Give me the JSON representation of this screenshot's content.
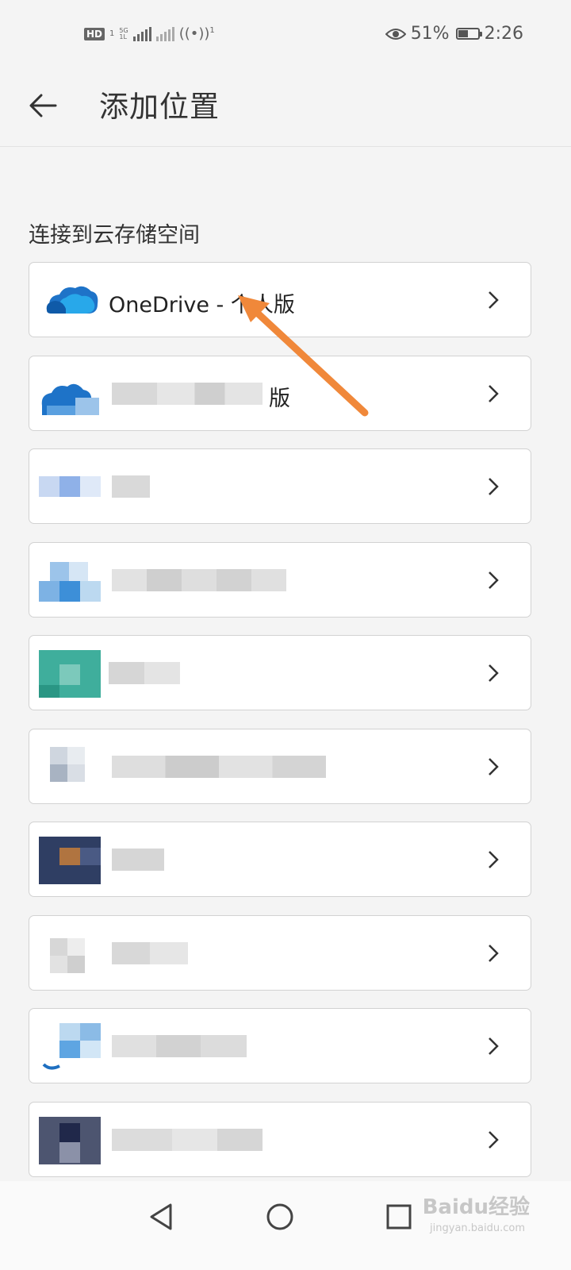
{
  "status_bar": {
    "hd": "HD",
    "sim": "1",
    "network": "5G",
    "network_sub": "1L",
    "hotspot_count": "1",
    "battery_percent": "51%",
    "battery_level": 0.51,
    "time": "2:26"
  },
  "app_bar": {
    "title": "添加位置",
    "back_icon": "arrow-left-icon"
  },
  "section": {
    "title": "连接到云存储空间"
  },
  "items": [
    {
      "label": "OneDrive - 个人版",
      "icon": "onedrive-cloud-icon"
    },
    {
      "label": "版",
      "icon": "onedrive-cloud-icon"
    },
    {
      "label": "",
      "icon": "pixelated-icon"
    },
    {
      "label": "",
      "icon": "pixelated-icon"
    },
    {
      "label": "",
      "icon": "pixelated-icon"
    },
    {
      "label": "",
      "icon": "pixelated-icon"
    },
    {
      "label": "",
      "icon": "pixelated-icon"
    },
    {
      "label": "",
      "icon": "pixelated-icon"
    },
    {
      "label": "",
      "icon": "pixelated-icon"
    },
    {
      "label": "",
      "icon": "pixelated-icon"
    }
  ],
  "watermark": {
    "text": "Baidu经验",
    "sub": "jingyan.baidu.com"
  },
  "colors": {
    "accent_arrow": "#f0883a",
    "onedrive_blue": "#1e73c8"
  }
}
